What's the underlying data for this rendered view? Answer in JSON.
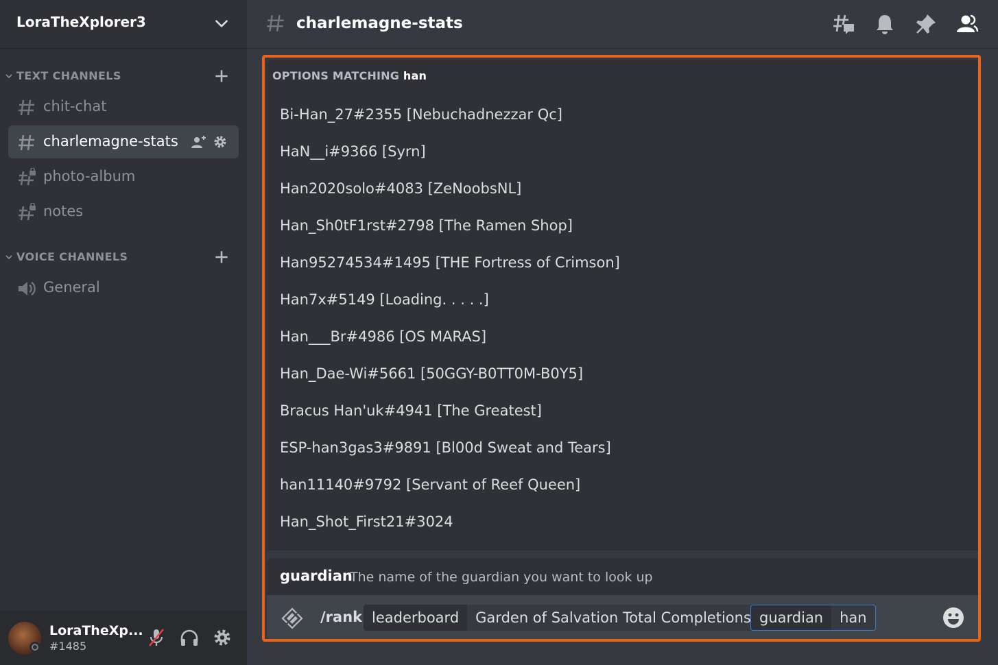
{
  "server": {
    "name": "LoraTheXplorer3"
  },
  "categories": {
    "text": {
      "label": "TEXT CHANNELS"
    },
    "voice": {
      "label": "VOICE CHANNELS"
    }
  },
  "channels": [
    {
      "name": "chit-chat",
      "icon": "hash-icon"
    },
    {
      "name": "charlemagne-stats",
      "icon": "hash-icon",
      "active": true
    },
    {
      "name": "photo-album",
      "icon": "hash-lock-icon"
    },
    {
      "name": "notes",
      "icon": "hash-lock-icon"
    }
  ],
  "voice_channels": [
    {
      "name": "General",
      "icon": "speaker-icon"
    }
  ],
  "user": {
    "name": "LoraTheXp...",
    "discriminator": "#1485"
  },
  "header": {
    "channel_title": "charlemagne-stats"
  },
  "autocomplete": {
    "title": "OPTIONS MATCHING",
    "query": "han",
    "options": [
      "Bi-Han_27#2355 [Nebuchadnezzar Qc]",
      "HaN__i#9366 [Syrn]",
      "Han2020solo#4083 [ZeNoobsNL]",
      "Han_Sh0tF1rst#2798 [The Ramen Shop]",
      "Han95274534#1495 [THE Fortress of Crimson]",
      "Han7x#5149 [Loading. . . . .]",
      "Han___Br#4986 [OS MARAS]",
      "Han_Dae-Wi#5661 [50GGY-B0TT0M-B0Y5]",
      "Bracus Han'uk#4941 [The Greatest]",
      "ESP-han3gas3#9891 [Bl00d Sweat and Tears]",
      "han11140#9792 [Servant of Reef Queen]",
      "Han_Shot_First21#3024"
    ]
  },
  "option_hint": {
    "name": "guardian",
    "description": "The name of the guardian you want to look up"
  },
  "command": {
    "name": "/rank",
    "params": [
      {
        "key": "leaderboard",
        "value": "Garden of Salvation Total Completions"
      },
      {
        "key": "guardian",
        "value": "han"
      }
    ]
  },
  "colors": {
    "accent_highlight": "#e8641b",
    "focus_border": "#3a7bd5"
  }
}
